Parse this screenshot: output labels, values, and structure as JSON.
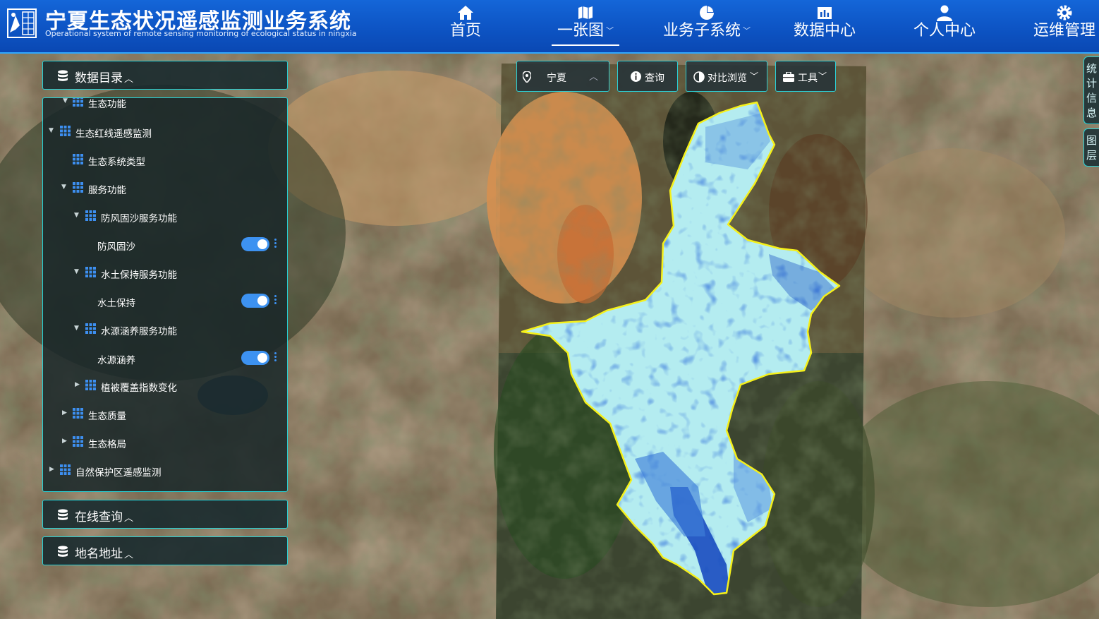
{
  "header": {
    "title": "宁夏生态状况遥感监测业务系统",
    "subtitle": "Operational system of remote sensing monitoring of ecological status in ningxia",
    "nav": [
      {
        "label": "首页",
        "icon": "home-icon",
        "active": false,
        "has_dropdown": false
      },
      {
        "label": "一张图",
        "icon": "map-icon",
        "active": true,
        "has_dropdown": true
      },
      {
        "label": "业务子系统",
        "icon": "pie-chart-icon",
        "active": false,
        "has_dropdown": true
      },
      {
        "label": "数据中心",
        "icon": "bar-chart-icon",
        "active": false,
        "has_dropdown": false
      },
      {
        "label": "个人中心",
        "icon": "user-icon",
        "active": false,
        "has_dropdown": false
      },
      {
        "label": "运维管理",
        "icon": "gear-icon",
        "active": false,
        "has_dropdown": false
      }
    ]
  },
  "panels": {
    "catalog_title": "数据目录",
    "query_title": "在线查询",
    "placename_title": "地名地址"
  },
  "tree": {
    "partial_top": "生态功能",
    "items": [
      {
        "label": "生态红线遥感监测",
        "expanded": true,
        "type": "group"
      },
      {
        "label": "生态系统类型",
        "type": "group"
      },
      {
        "label": "服务功能",
        "expanded": true,
        "type": "group"
      },
      {
        "label": "防风固沙服务功能",
        "expanded": true,
        "type": "group"
      },
      {
        "label": "防风固沙",
        "type": "layer",
        "enabled": true
      },
      {
        "label": "水土保持服务功能",
        "expanded": true,
        "type": "group"
      },
      {
        "label": "水土保持",
        "type": "layer",
        "enabled": true
      },
      {
        "label": "水源涵养服务功能",
        "expanded": true,
        "type": "group"
      },
      {
        "label": "水源涵养",
        "type": "layer",
        "enabled": true
      },
      {
        "label": "植被覆盖指数变化",
        "expanded": false,
        "type": "group"
      },
      {
        "label": "生态质量",
        "expanded": false,
        "type": "group"
      },
      {
        "label": "生态格局",
        "expanded": false,
        "type": "group"
      },
      {
        "label": "自然保护区遥感监测",
        "expanded": false,
        "type": "group"
      }
    ]
  },
  "toolbar": {
    "region": "宁夏",
    "query": "查询",
    "compare": "对比浏览",
    "tools": "工具"
  },
  "side_tabs": {
    "stats": "统计信息",
    "layers": "图层"
  },
  "colors": {
    "header_blue": "#0d54c4",
    "panel_border": "#26d3d8",
    "toggle_on": "#3d92f1",
    "boundary_yellow": "#f5f01a",
    "water_light": "#b4ecf0",
    "water_dark": "#1a4cc0"
  }
}
